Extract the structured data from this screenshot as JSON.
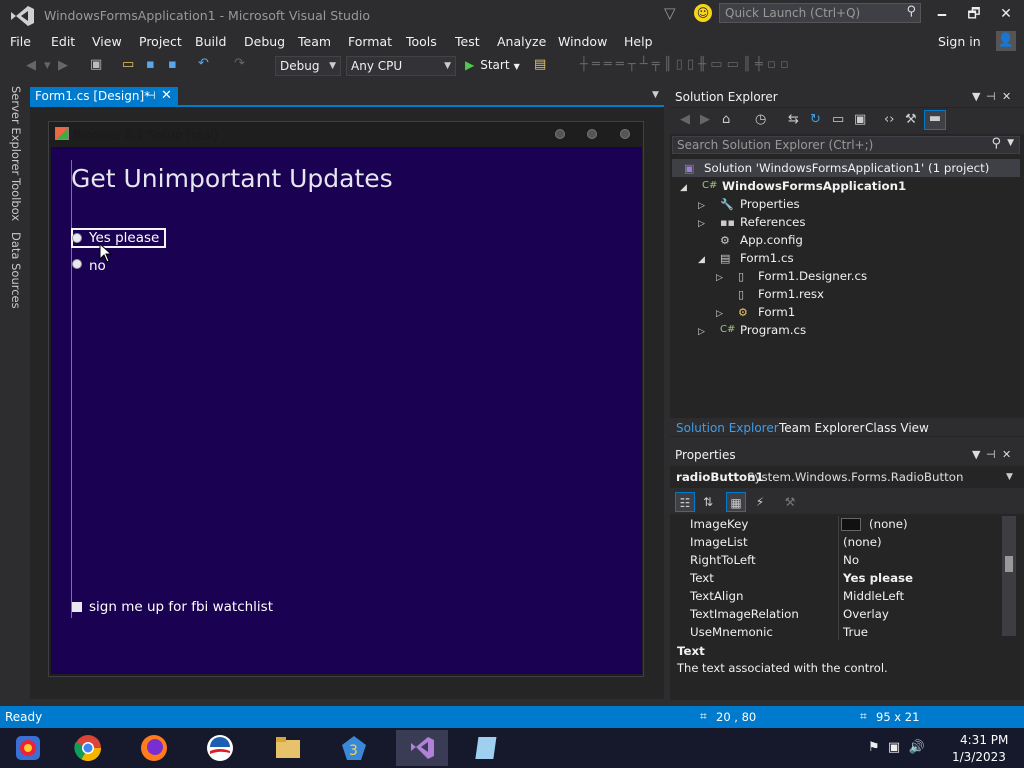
{
  "window": {
    "title": "WindowsFormsApplication1 - Microsoft Visual Studio",
    "quick_launch_placeholder": "Quick Launch (Ctrl+Q)",
    "minimize": "🗕",
    "restore": "🗗",
    "close": "✕"
  },
  "menu": {
    "items": [
      "File",
      "Edit",
      "View",
      "Project",
      "Build",
      "Debug",
      "Team",
      "Format",
      "Tools",
      "Test",
      "Analyze",
      "Window",
      "Help"
    ],
    "sign_in": "Sign in"
  },
  "toolbar": {
    "configuration": "Debug",
    "platform": "Any CPU",
    "start": "Start"
  },
  "left_tabs": [
    "Server Explorer",
    "Toolbox",
    "Data Sources"
  ],
  "document": {
    "tab_label": "Form1.cs [Design]*"
  },
  "form": {
    "title": "Bindoes 8.1 Setup (real)",
    "heading": "Get Unimportant Updates",
    "radio1": "Yes please",
    "radio2": "no",
    "checkbox": "sign me up for fbi watchlist",
    "background_color": "#1a0152"
  },
  "solution_explorer": {
    "title": "Solution Explorer",
    "search_placeholder": "Search Solution Explorer (Ctrl+;)",
    "tree": [
      {
        "label": "Solution 'WindowsFormsApplication1' (1 project)",
        "level": 0,
        "icon": "solution-icon"
      },
      {
        "label": "WindowsFormsApplication1",
        "level": 1,
        "icon": "csharp-project-icon",
        "bold": true
      },
      {
        "label": "Properties",
        "level": 2,
        "icon": "wrench-icon"
      },
      {
        "label": "References",
        "level": 2,
        "icon": "references-icon"
      },
      {
        "label": "App.config",
        "level": 2,
        "icon": "config-icon"
      },
      {
        "label": "Form1.cs",
        "level": 2,
        "icon": "form-icon"
      },
      {
        "label": "Form1.Designer.cs",
        "level": 3,
        "icon": "cs-file-icon"
      },
      {
        "label": "Form1.resx",
        "level": 3,
        "icon": "resx-icon"
      },
      {
        "label": "Form1",
        "level": 3,
        "icon": "class-icon"
      },
      {
        "label": "Program.cs",
        "level": 2,
        "icon": "csharp-file-icon"
      }
    ],
    "tabs": [
      "Solution Explorer",
      "Team Explorer",
      "Class View"
    ]
  },
  "properties": {
    "title": "Properties",
    "object_name": "radioButton1",
    "object_type": "System.Windows.Forms.RadioButton",
    "rows": [
      {
        "name": "ImageKey",
        "value": "(none)"
      },
      {
        "name": "ImageList",
        "value": "(none)"
      },
      {
        "name": "RightToLeft",
        "value": "No"
      },
      {
        "name": "Text",
        "value": "Yes please"
      },
      {
        "name": "TextAlign",
        "value": "MiddleLeft"
      },
      {
        "name": "TextImageRelation",
        "value": "Overlay"
      },
      {
        "name": "UseMnemonic",
        "value": "True"
      }
    ],
    "desc_title": "Text",
    "desc_text": "The text associated with the control."
  },
  "status": {
    "text": "Ready",
    "position": "20 , 80",
    "size": "95 x 21"
  },
  "taskbar": {
    "time": "4:31 PM",
    "date": "1/3/2023"
  },
  "colors": {
    "accent": "#007acc",
    "chrome": "#2d2d30",
    "taskbar": "#16182b"
  }
}
